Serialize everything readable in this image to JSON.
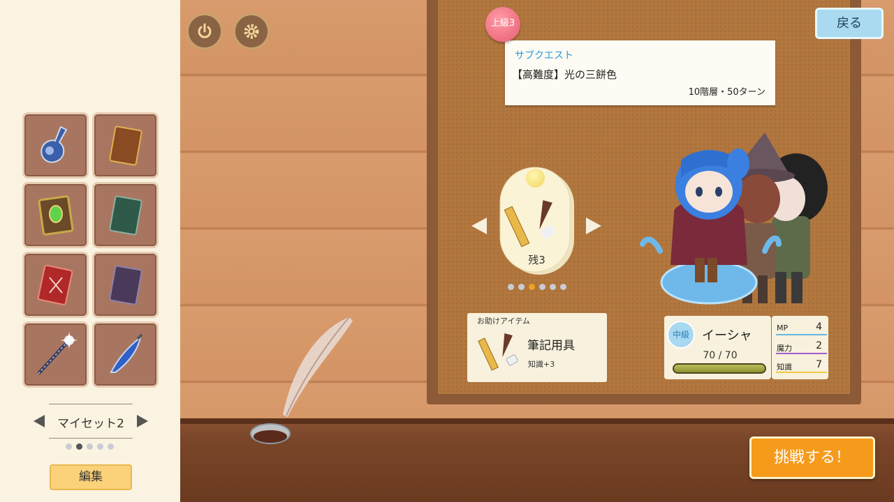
{
  "sidebar": {
    "myset": {
      "label": "マイセット2"
    },
    "edit_label": "編集",
    "items": [
      {
        "icon": "potion-flask-icon"
      },
      {
        "icon": "brown-book-icon"
      },
      {
        "icon": "green-gem-tome-icon"
      },
      {
        "icon": "teal-book-icon"
      },
      {
        "icon": "red-book-icon"
      },
      {
        "icon": "purple-book-icon"
      },
      {
        "icon": "crystal-wand-icon"
      },
      {
        "icon": "blue-dagger-icon"
      }
    ]
  },
  "quest": {
    "level_badge": "上級3",
    "type": "サブクエスト",
    "name": "【高難度】光の三餅色",
    "detail": "10階層・50ターン"
  },
  "top": {
    "back_label": "戻る"
  },
  "helper": {
    "remaining": "残3",
    "card_title": "お助けアイテム",
    "name": "筆記用具",
    "effect": "知識+3"
  },
  "character": {
    "rank": "中級",
    "name": "イーシャ",
    "hp_text": "70 / 70",
    "hp_fraction": 1.0,
    "stats": [
      {
        "label": "MP",
        "value": "4",
        "color": "#67b6e0"
      },
      {
        "label": "魔力",
        "value": "2",
        "color": "#a05fd0"
      },
      {
        "label": "知識",
        "value": "7",
        "color": "#f0c840"
      }
    ]
  },
  "challenge_label": "挑戦する！"
}
